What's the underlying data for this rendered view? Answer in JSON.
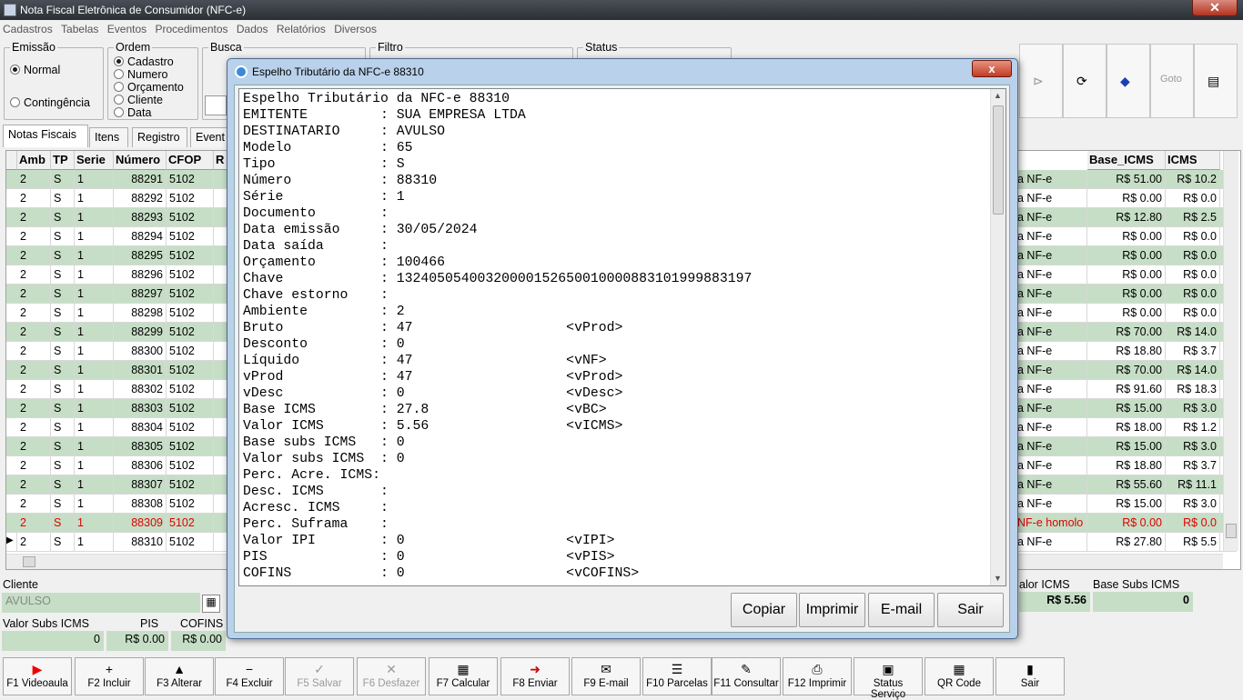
{
  "window": {
    "title": "Nota Fiscal Eletrônica de Consumidor (NFC-e)"
  },
  "menu": [
    "Cadastros",
    "Tabelas",
    "Eventos",
    "Procedimentos",
    "Dados",
    "Relatórios",
    "Diversos"
  ],
  "emissao": {
    "legend": "Emissão",
    "options": [
      "Normal",
      "Contingência"
    ]
  },
  "ordem": {
    "legend": "Ordem",
    "options": [
      "Cadastro",
      "Numero",
      "Orçamento",
      "Cliente",
      "Data"
    ]
  },
  "busca": {
    "legend": "Busca"
  },
  "filtro": {
    "legend": "Filtro"
  },
  "status": {
    "legend": "Status"
  },
  "tabs": [
    "Notas Fiscais",
    "Itens",
    "Registro",
    "Event"
  ],
  "grid": {
    "headers": [
      "Amb",
      "TP",
      "Serie",
      "Número",
      "CFOP",
      "R"
    ],
    "right_headers": [
      "Base_ICMS",
      "ICMS"
    ],
    "rows": [
      {
        "amb": "2",
        "tp": "S",
        "serie": "1",
        "numero": "88291",
        "cfop": "5102",
        "obs": "a NF-e",
        "base": "R$ 51.00",
        "icms": "R$ 10.2"
      },
      {
        "amb": "2",
        "tp": "S",
        "serie": "1",
        "numero": "88292",
        "cfop": "5102",
        "obs": "a NF-e",
        "base": "R$ 0.00",
        "icms": "R$ 0.0"
      },
      {
        "amb": "2",
        "tp": "S",
        "serie": "1",
        "numero": "88293",
        "cfop": "5102",
        "obs": "a NF-e",
        "base": "R$ 12.80",
        "icms": "R$ 2.5"
      },
      {
        "amb": "2",
        "tp": "S",
        "serie": "1",
        "numero": "88294",
        "cfop": "5102",
        "obs": "a NF-e",
        "base": "R$ 0.00",
        "icms": "R$ 0.0"
      },
      {
        "amb": "2",
        "tp": "S",
        "serie": "1",
        "numero": "88295",
        "cfop": "5102",
        "obs": "a NF-e",
        "base": "R$ 0.00",
        "icms": "R$ 0.0"
      },
      {
        "amb": "2",
        "tp": "S",
        "serie": "1",
        "numero": "88296",
        "cfop": "5102",
        "obs": "a NF-e",
        "base": "R$ 0.00",
        "icms": "R$ 0.0"
      },
      {
        "amb": "2",
        "tp": "S",
        "serie": "1",
        "numero": "88297",
        "cfop": "5102",
        "obs": "a NF-e",
        "base": "R$ 0.00",
        "icms": "R$ 0.0"
      },
      {
        "amb": "2",
        "tp": "S",
        "serie": "1",
        "numero": "88298",
        "cfop": "5102",
        "obs": "a NF-e",
        "base": "R$ 0.00",
        "icms": "R$ 0.0"
      },
      {
        "amb": "2",
        "tp": "S",
        "serie": "1",
        "numero": "88299",
        "cfop": "5102",
        "obs": "a NF-e",
        "base": "R$ 70.00",
        "icms": "R$ 14.0"
      },
      {
        "amb": "2",
        "tp": "S",
        "serie": "1",
        "numero": "88300",
        "cfop": "5102",
        "obs": "a NF-e",
        "base": "R$ 18.80",
        "icms": "R$ 3.7"
      },
      {
        "amb": "2",
        "tp": "S",
        "serie": "1",
        "numero": "88301",
        "cfop": "5102",
        "obs": "a NF-e",
        "base": "R$ 70.00",
        "icms": "R$ 14.0"
      },
      {
        "amb": "2",
        "tp": "S",
        "serie": "1",
        "numero": "88302",
        "cfop": "5102",
        "obs": "a NF-e",
        "base": "R$ 91.60",
        "icms": "R$ 18.3"
      },
      {
        "amb": "2",
        "tp": "S",
        "serie": "1",
        "numero": "88303",
        "cfop": "5102",
        "obs": "a NF-e",
        "base": "R$ 15.00",
        "icms": "R$ 3.0"
      },
      {
        "amb": "2",
        "tp": "S",
        "serie": "1",
        "numero": "88304",
        "cfop": "5102",
        "obs": "a NF-e",
        "base": "R$ 18.00",
        "icms": "R$ 1.2"
      },
      {
        "amb": "2",
        "tp": "S",
        "serie": "1",
        "numero": "88305",
        "cfop": "5102",
        "obs": "a NF-e",
        "base": "R$ 15.00",
        "icms": "R$ 3.0"
      },
      {
        "amb": "2",
        "tp": "S",
        "serie": "1",
        "numero": "88306",
        "cfop": "5102",
        "obs": "a NF-e",
        "base": "R$ 18.80",
        "icms": "R$ 3.7"
      },
      {
        "amb": "2",
        "tp": "S",
        "serie": "1",
        "numero": "88307",
        "cfop": "5102",
        "obs": "a NF-e",
        "base": "R$ 55.60",
        "icms": "R$ 11.1"
      },
      {
        "amb": "2",
        "tp": "S",
        "serie": "1",
        "numero": "88308",
        "cfop": "5102",
        "obs": "a NF-e",
        "base": "R$ 15.00",
        "icms": "R$ 3.0"
      },
      {
        "amb": "2",
        "tp": "S",
        "serie": "1",
        "numero": "88309",
        "cfop": "5102",
        "obs": "NF-e homolo",
        "base": "R$ 0.00",
        "icms": "R$ 0.0"
      },
      {
        "amb": "2",
        "tp": "S",
        "serie": "1",
        "numero": "88310",
        "cfop": "5102",
        "obs": "a NF-e",
        "base": "R$ 27.80",
        "icms": "R$ 5.5"
      }
    ]
  },
  "bottom": {
    "cliente_label": "Cliente",
    "cliente_value": "AVULSO",
    "valor_subs_label": "Valor Subs ICMS",
    "valor_subs_value": "0",
    "pis_label": "PIS",
    "pis_value": "R$ 0.00",
    "cofins_label": "COFINS",
    "cofins_value": "R$ 0.00",
    "valor_icms_label": "alor ICMS",
    "valor_icms_value": "R$ 5.56",
    "base_subs_label": "Base Subs ICMS",
    "base_subs_value": "0"
  },
  "fkeys": [
    {
      "label": "F1 Videoaula",
      "icon": "▶"
    },
    {
      "label": "F2 Incluir",
      "icon": "+"
    },
    {
      "label": "F3 Alterar",
      "icon": "▲"
    },
    {
      "label": "F4 Excluir",
      "icon": "−"
    },
    {
      "label": "F5 Salvar",
      "icon": "✓"
    },
    {
      "label": "F6 Desfazer",
      "icon": "✕"
    },
    {
      "label": "F7 Calcular",
      "icon": "▦"
    },
    {
      "label": "F8 Enviar",
      "icon": "➜"
    },
    {
      "label": "F9 E-mail",
      "icon": "✉"
    },
    {
      "label": "F10 Parcelas",
      "icon": "☰"
    },
    {
      "label": "F11 Consultar",
      "icon": "✎"
    },
    {
      "label": "F12 Imprimir",
      "icon": "⎙"
    },
    {
      "label": "Status Serviço",
      "icon": "▣"
    },
    {
      "label": "QR Code",
      "icon": "▦"
    },
    {
      "label": "Sair",
      "icon": "▮"
    }
  ],
  "modal": {
    "title": "Espelho Tributário da NFC-e 88310",
    "close": "x",
    "content": "Espelho Tributário da NFC-e 88310\nEMITENTE         : SUA EMPRESA LTDA\nDESTINATARIO     : AVULSO\nModelo           : 65\nTipo             : S\nNúmero           : 88310\nSérie            : 1\nDocumento        :\nData emissão     : 30/05/2024\nData saída       :\nOrçamento        : 100466\nChave            : 13240505400320000152650010000883101999883197\nChave estorno    :\nAmbiente         : 2\nBruto            : 47                   <vProd>\nDesconto         : 0\nLíquido          : 47                   <vNF>\nvProd            : 47                   <vProd>\nvDesc            : 0                    <vDesc>\nBase ICMS        : 27.8                 <vBC>\nValor ICMS       : 5.56                 <vICMS>\nBase subs ICMS   : 0\nValor subs ICMS  : 0\nPerc. Acre. ICMS:\nDesc. ICMS       :\nAcresc. ICMS     :\nPerc. Suframa    :\nValor IPI        : 0                    <vIPI>\nPIS              : 0                    <vPIS>\nCOFINS           : 0                    <vCOFINS>",
    "buttons": [
      "Copiar",
      "Imprimir",
      "E-mail",
      "Sair"
    ]
  }
}
